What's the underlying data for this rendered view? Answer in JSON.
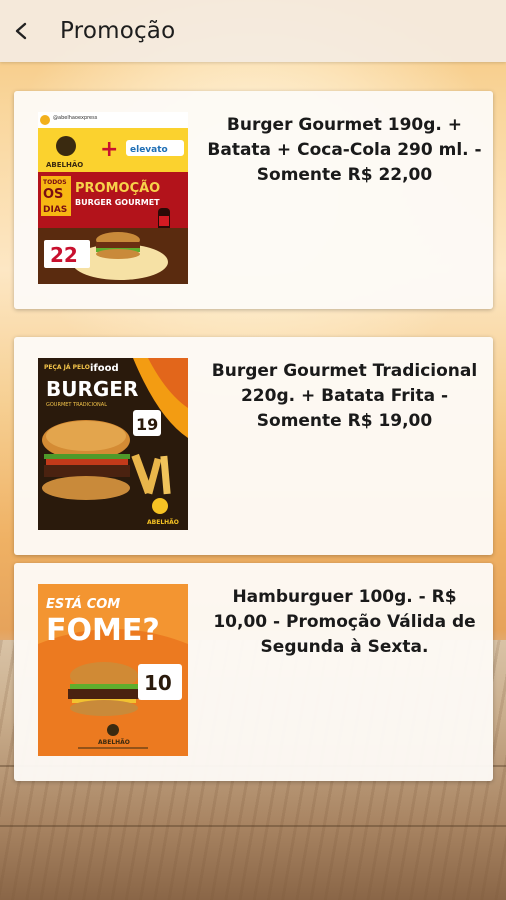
{
  "header": {
    "title": "Promoção",
    "back_icon": "chevron-left-icon"
  },
  "promotions": [
    {
      "text": "Burger Gourmet 190g. + Batata + Coca-Cola 290 ml.  - Somente R$ 22,00",
      "image": {
        "account": "@abelhaoexpress",
        "brand": "ABELHÃO",
        "partner": "elevato",
        "badge_top": "TODOS",
        "badge_mid": "OS",
        "badge_bottom": "DIAS",
        "headline": "PROMOÇÃO",
        "subheadline": "BURGER GOURMET",
        "price": "22"
      }
    },
    {
      "text": "Burger Gourmet Tradicional 220g. + Batata Frita - Somente R$ 19,00",
      "image": {
        "order_line": "PEÇA JÁ PELO",
        "app": "ifood",
        "headline": "BURGER",
        "subheadline": "GOURMET TRADICIONAL",
        "price": "19",
        "brand": "ABELHÃO"
      }
    },
    {
      "text": "Hamburguer 100g. - R$ 10,00 - Promoção Válida de Segunda à Sexta.",
      "image": {
        "line1": "ESTÁ COM",
        "line2": "FOME?",
        "price": "10",
        "brand": "ABELHÃO"
      }
    }
  ],
  "colors": {
    "header_bg": "#f4ece2",
    "card_bg": "#fdfaf6",
    "text": "#1a1a1a",
    "accent_orange": "#e2661b",
    "accent_red": "#c8102e"
  }
}
